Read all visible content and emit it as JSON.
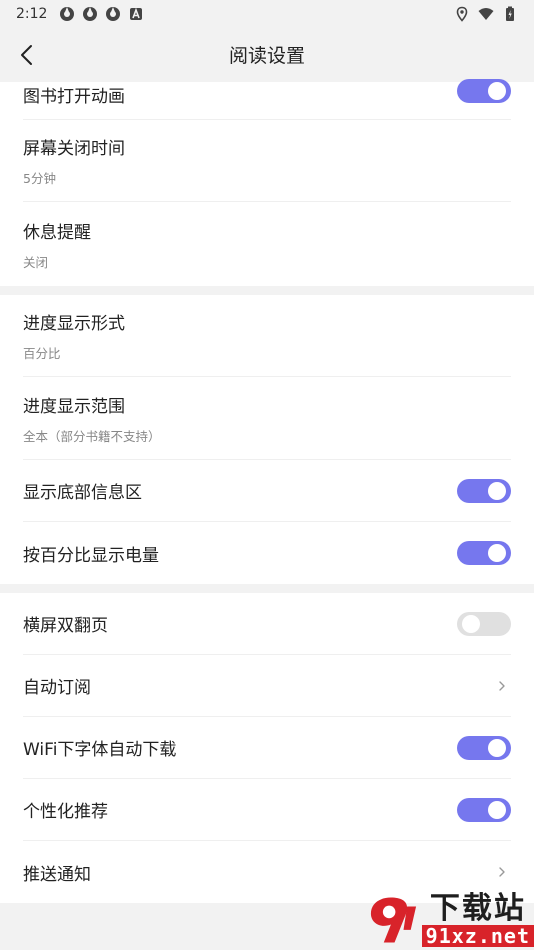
{
  "status_bar": {
    "time": "2:12",
    "notification_icons": [
      "app-icon",
      "app-icon",
      "app-icon",
      "text-a-icon"
    ],
    "right_icons": [
      "location-icon",
      "wifi-icon",
      "battery-icon"
    ]
  },
  "header": {
    "title": "阅读设置"
  },
  "groups": [
    {
      "items": [
        {
          "label": "图书打开动画",
          "control": "switch",
          "on": true
        },
        {
          "label": "屏幕关闭时间",
          "sub": "5分钟"
        },
        {
          "label": "休息提醒",
          "sub": "关闭"
        }
      ]
    },
    {
      "items": [
        {
          "label": "进度显示形式",
          "sub": "百分比"
        },
        {
          "label": "进度显示范围",
          "sub": "全本（部分书籍不支持）"
        },
        {
          "label": "显示底部信息区",
          "control": "switch",
          "on": true
        },
        {
          "label": "按百分比显示电量",
          "control": "switch",
          "on": true
        }
      ]
    },
    {
      "items": [
        {
          "label": "横屏双翻页",
          "control": "switch",
          "on": false
        },
        {
          "label": "自动订阅",
          "control": "chevron"
        },
        {
          "label": "WiFi下字体自动下载",
          "control": "switch",
          "on": true
        },
        {
          "label": "个性化推荐",
          "control": "switch",
          "on": true
        },
        {
          "label": "推送通知",
          "control": "chevron"
        }
      ]
    }
  ],
  "watermark": {
    "top": "下载站",
    "bottom": "91xz.net"
  },
  "colors": {
    "accent": "#7677ee",
    "switch_off": "#e0e0e0",
    "background": "#f2f2f2",
    "watermark_red": "#d8232a"
  }
}
